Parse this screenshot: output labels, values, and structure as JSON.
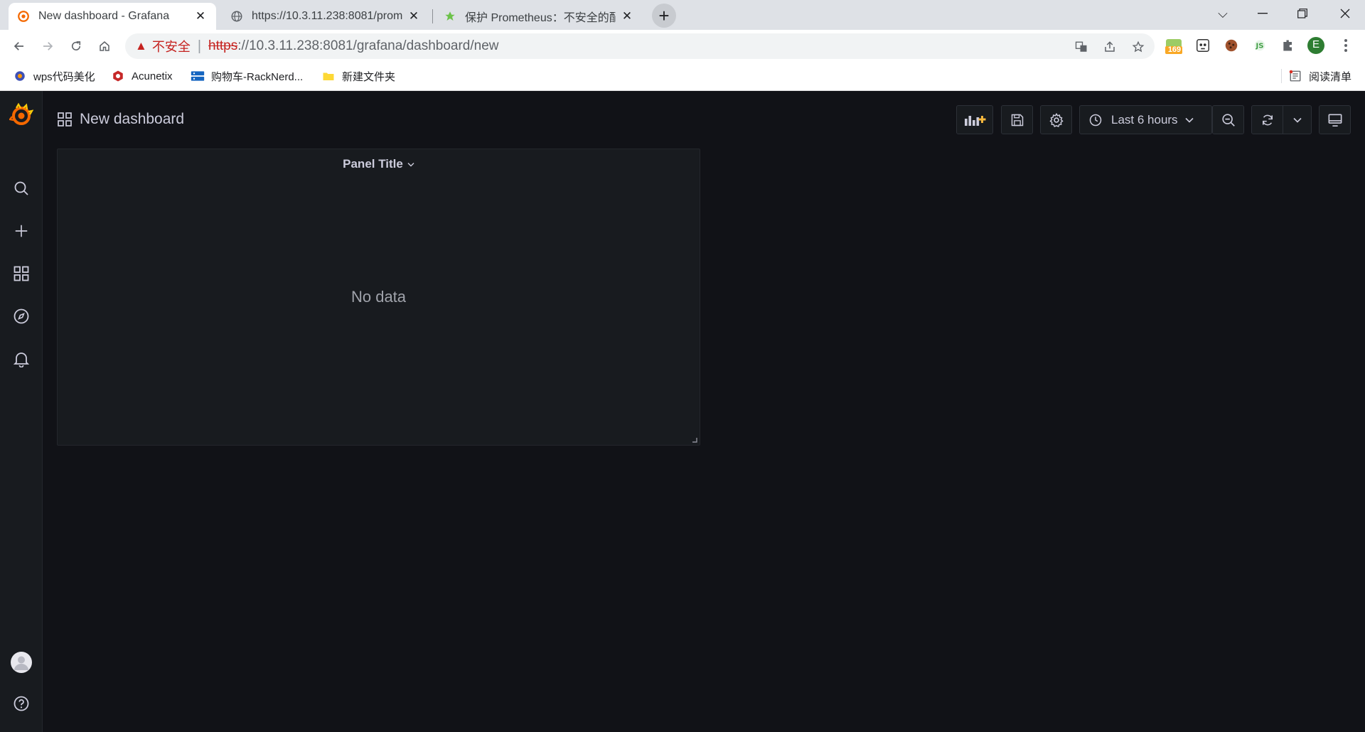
{
  "tabs": [
    {
      "label": "New dashboard - Grafana",
      "active": true,
      "icon": "grafana-icon"
    },
    {
      "label": "https://10.3.11.238:8081/prom",
      "active": false,
      "icon": "globe-icon"
    },
    {
      "label": "保护 Prometheus：不安全的配",
      "active": false,
      "icon": "prometheus-icon"
    }
  ],
  "omnibox": {
    "security_label": "不安全",
    "url_scheme": "https",
    "url_rest": "://10.3.11.238:8081/grafana/dashboard/new"
  },
  "extensions": {
    "badge_count": "169",
    "profile_initial": "E"
  },
  "bookmarks": [
    {
      "label": "wps代码美化"
    },
    {
      "label": "Acunetix"
    },
    {
      "label": "购物车-RackNerd..."
    },
    {
      "label": "新建文件夹"
    }
  ],
  "reading_list_label": "阅读清单",
  "dashboard": {
    "title": "New dashboard",
    "time_range": "Last 6 hours"
  },
  "panel": {
    "title": "Panel Title",
    "empty_message": "No data"
  },
  "colors": {
    "grafana_orange": "#f46800",
    "grafana_bg": "#111217",
    "panel_bg": "#181b1f",
    "warning_red": "#c5221f"
  }
}
